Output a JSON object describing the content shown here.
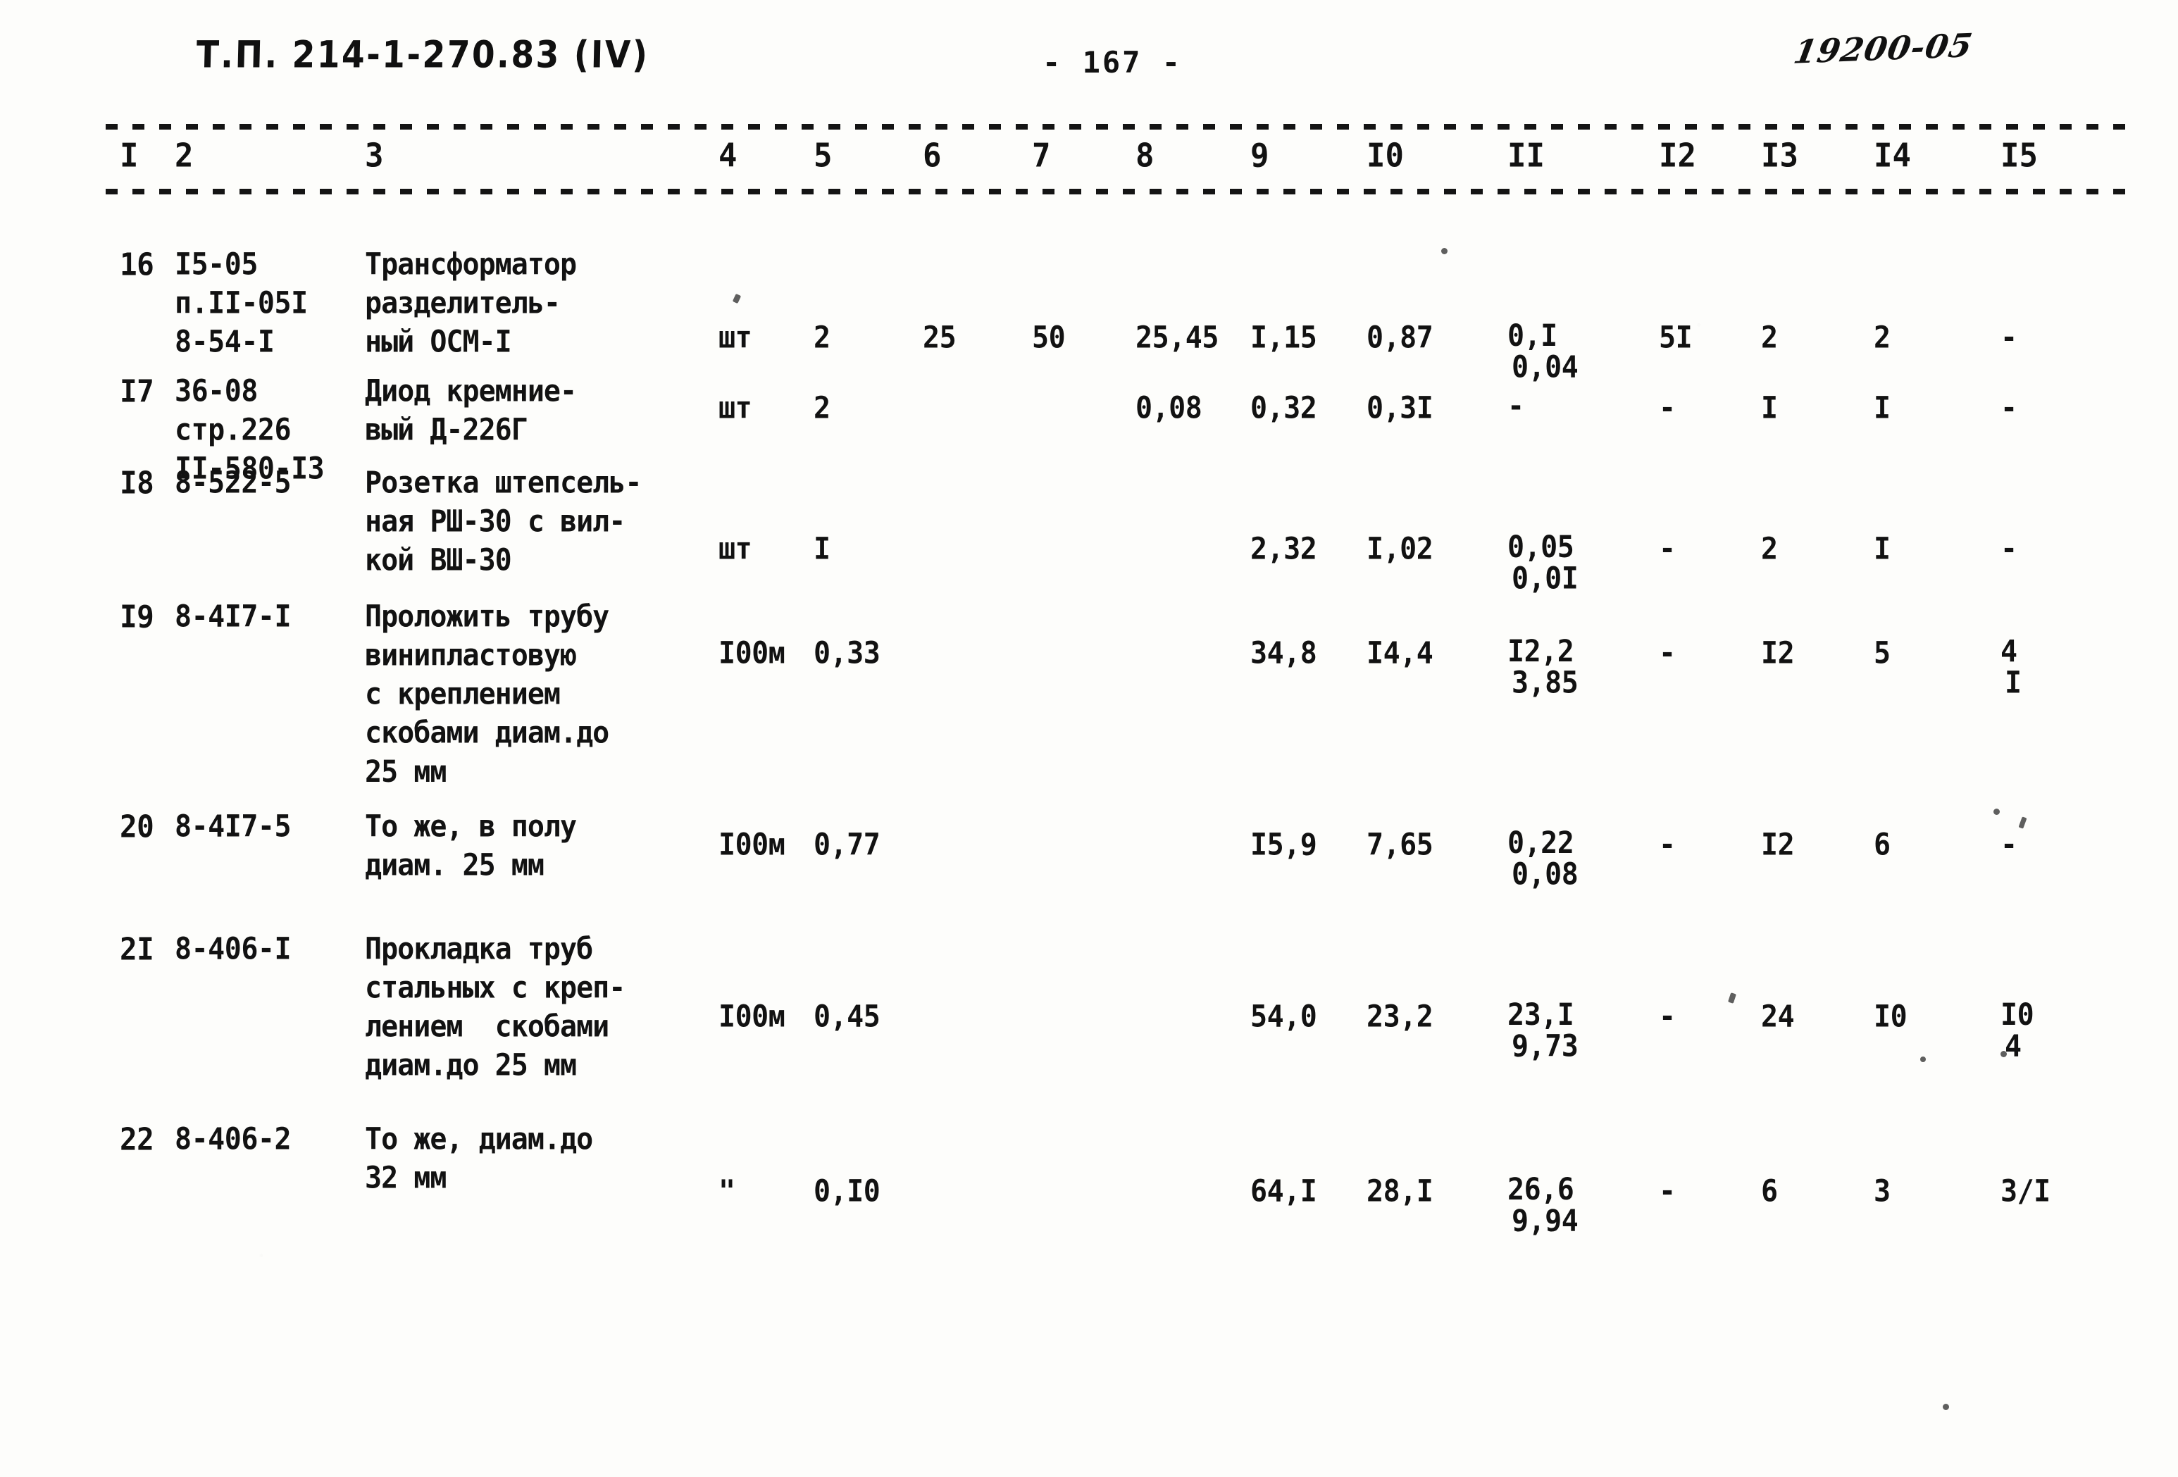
{
  "header": {
    "doc_code": "Т.П. 214-1-270.83 (IV)",
    "page_number": "- 167 -",
    "stamp_number": "19200-05"
  },
  "table": {
    "column_headers": [
      "I",
      "2",
      "3",
      "4",
      "5",
      "6",
      "7",
      "8",
      "9",
      "I0",
      "II",
      "I2",
      "I3",
      "I4",
      "I5"
    ],
    "rows": [
      {
        "num": "16",
        "code": "I5-05\nп.II-05I\n8-54-I",
        "description": "Трансформатор\nразделитель-\nный ОСМ-I",
        "unit": "шт",
        "qty": "2",
        "c6": "25",
        "c7": "50",
        "c8": "25,45",
        "c9": "I,15",
        "c10": "0,87",
        "c11_top": "0,I",
        "c11_bottom": "0,04",
        "c12": "5I",
        "c13": "2",
        "c14": "2",
        "c15": "-"
      },
      {
        "num": "I7",
        "code": "36-08\nстр.226\nII-580-I3",
        "description": "Диод кремние-\nвый Д-226Г",
        "unit": "шт",
        "qty": "2",
        "c6": "",
        "c7": "",
        "c8": "0,08",
        "c9": "0,32",
        "c10": "0,3I",
        "c11_top": "-",
        "c11_bottom": "",
        "c12": "-",
        "c13": "I",
        "c14": "I",
        "c15": "-"
      },
      {
        "num": "I8",
        "code": "8-522-5",
        "description": "Розетка штепсель-\nная РШ-30 с вил-\nкой ВШ-30",
        "unit": "шт",
        "qty": "I",
        "c6": "",
        "c7": "",
        "c8": "",
        "c9": "2,32",
        "c10": "I,02",
        "c11_top": "0,05",
        "c11_bottom": "0,0I",
        "c12": "-",
        "c13": "2",
        "c14": "I",
        "c15": "-"
      },
      {
        "num": "I9",
        "code": "8-4I7-I",
        "description": "Проложить трубу\nвинипластовую\nс креплением\nскобами диам.до\n25 мм",
        "unit": "I00м",
        "qty": "0,33",
        "c6": "",
        "c7": "",
        "c8": "",
        "c9": "34,8",
        "c10": "I4,4",
        "c11_top": "I2,2",
        "c11_bottom": "3,85",
        "c12": "-",
        "c13": "I2",
        "c14": "5",
        "c15_top": "4",
        "c15_bottom": "I"
      },
      {
        "num": "20",
        "code": "8-4I7-5",
        "description": "То же, в полу\nдиам. 25 мм",
        "unit": "I00м",
        "qty": "0,77",
        "c6": "",
        "c7": "",
        "c8": "",
        "c9": "I5,9",
        "c10": "7,65",
        "c11_top": "0,22",
        "c11_bottom": "0,08",
        "c12": "-",
        "c13": "I2",
        "c14": "6",
        "c15": "-"
      },
      {
        "num": "2I",
        "code": "8-406-I",
        "description": "Прокладка труб\nстальных с креп-\nлением  скобами\nдиам.до 25 мм",
        "unit": "I00м",
        "qty": "0,45",
        "c6": "",
        "c7": "",
        "c8": "",
        "c9": "54,0",
        "c10": "23,2",
        "c11_top": "23,I",
        "c11_bottom": "9,73",
        "c12": "-",
        "c13": "24",
        "c14": "I0",
        "c15_top": "I0",
        "c15_bottom": "4"
      },
      {
        "num": "22",
        "code": "8-406-2",
        "description": "То же, диам.до\n32 мм",
        "unit": "\"",
        "qty": "0,I0",
        "c6": "",
        "c7": "",
        "c8": "",
        "c9": "64,I",
        "c10": "28,I",
        "c11_top": "26,6",
        "c11_bottom": "9,94",
        "c12": "-",
        "c13": "6",
        "c14": "3",
        "c15": "3/I"
      }
    ]
  }
}
